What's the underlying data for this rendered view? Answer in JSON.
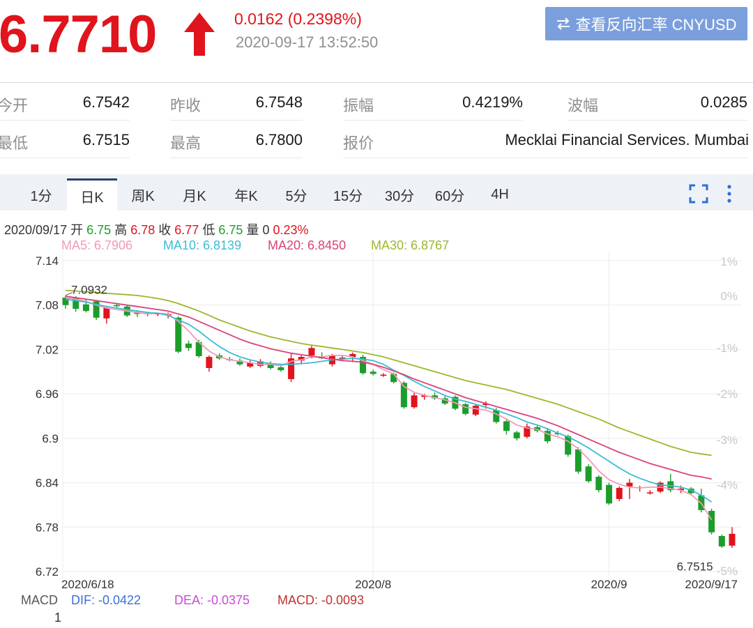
{
  "header": {
    "price": "6.7710",
    "change": "0.0162 (0.2398%)",
    "timestamp": "2020-09-17 13:52:50",
    "reverse_button": "查看反向汇率 CNYUSD"
  },
  "stats": [
    {
      "label": "今开",
      "value": "6.7542"
    },
    {
      "label": "昨收",
      "value": "6.7548"
    },
    {
      "label": "振幅",
      "value": "0.4219%"
    },
    {
      "label": "波幅",
      "value": "0.0285"
    },
    {
      "label": "最低",
      "value": "6.7515"
    },
    {
      "label": "最高",
      "value": "6.7800"
    },
    {
      "label": "报价",
      "value": "Mecklai Financial Services. Mumbai"
    }
  ],
  "tabs": [
    "1分",
    "日K",
    "周K",
    "月K",
    "年K",
    "5分",
    "15分",
    "30分",
    "60分",
    "4H"
  ],
  "active_tab": "日K",
  "info": {
    "date": "2020/09/17",
    "open_label": "开",
    "open": "6.75",
    "high_label": "高",
    "high": "6.78",
    "close_label": "收",
    "close": "6.77",
    "low_label": "低",
    "low": "6.75",
    "vol_label": "量",
    "vol": "0",
    "pct": "0.23%"
  },
  "ma": [
    {
      "label": "MA5: 6.7906",
      "color": "#f09bb8"
    },
    {
      "label": "MA10: 6.8139",
      "color": "#3cbcd3"
    },
    {
      "label": "MA20: 6.8450",
      "color": "#d9427a"
    },
    {
      "label": "MA30: 6.8767",
      "color": "#9ab82c"
    }
  ],
  "macd": {
    "label": "MACD",
    "dif": "DIF: -0.0422",
    "dea": "DEA: -0.0375",
    "macd": "MACD: -0.0093",
    "axis_tick": "1"
  },
  "colors": {
    "up": "#e0141c",
    "down": "#1b9d2b",
    "accent_button": "#7b9fdd"
  },
  "chart_data": {
    "type": "candlestick",
    "ylim": [
      6.72,
      7.14
    ],
    "y_ticks": [
      "7.14",
      "7.08",
      "7.02",
      "6.96",
      "6.9",
      "6.84",
      "6.78",
      "6.72"
    ],
    "y_tick_values": [
      7.14,
      7.08,
      7.02,
      6.96,
      6.9,
      6.84,
      6.78,
      6.72
    ],
    "pct_ticks": [
      "1%",
      "0%",
      "-1%",
      "-2%",
      "-3%",
      "-4%",
      "-5%"
    ],
    "pct_tick_values": [
      7.14,
      7.0932,
      7.023,
      6.961,
      6.899,
      6.838,
      6.722
    ],
    "x_labels": [
      {
        "label": "2020/6/18",
        "index": 0
      },
      {
        "label": "2020/8",
        "index": 30
      },
      {
        "label": "2020/9",
        "index": 53
      },
      {
        "label": "2020/9/17",
        "index": 63
      }
    ],
    "grid_x_indices": [
      30,
      53
    ],
    "annotations": [
      {
        "text": "7.0932",
        "index": 0,
        "value": 7.0932
      },
      {
        "text": "6.7515",
        "index": 63,
        "value": 6.7515
      }
    ],
    "candles": [
      {
        "o": 7.09,
        "h": 7.093,
        "l": 7.075,
        "c": 7.08
      },
      {
        "o": 7.09,
        "h": 7.092,
        "l": 7.071,
        "c": 7.075
      },
      {
        "o": 7.081,
        "h": 7.088,
        "l": 7.07,
        "c": 7.072
      },
      {
        "o": 7.085,
        "h": 7.087,
        "l": 7.06,
        "c": 7.063
      },
      {
        "o": 7.062,
        "h": 7.078,
        "l": 7.055,
        "c": 7.076
      },
      {
        "o": 7.08,
        "h": 7.083,
        "l": 7.077,
        "c": 7.079
      },
      {
        "o": 7.078,
        "h": 7.08,
        "l": 7.064,
        "c": 7.066
      },
      {
        "o": 7.07,
        "h": 7.073,
        "l": 7.064,
        "c": 7.068
      },
      {
        "o": 7.068,
        "h": 7.071,
        "l": 7.065,
        "c": 7.069
      },
      {
        "o": 7.068,
        "h": 7.07,
        "l": 7.065,
        "c": 7.069
      },
      {
        "o": 7.066,
        "h": 7.07,
        "l": 7.062,
        "c": 7.068
      },
      {
        "o": 7.063,
        "h": 7.065,
        "l": 7.015,
        "c": 7.017
      },
      {
        "o": 7.028,
        "h": 7.032,
        "l": 7.018,
        "c": 7.022
      },
      {
        "o": 7.03,
        "h": 7.033,
        "l": 7.009,
        "c": 7.011
      },
      {
        "o": 6.995,
        "h": 7.012,
        "l": 6.99,
        "c": 7.01
      },
      {
        "o": 7.012,
        "h": 7.015,
        "l": 7.006,
        "c": 7.008
      },
      {
        "o": 7.007,
        "h": 7.01,
        "l": 7.004,
        "c": 7.006
      },
      {
        "o": 7.005,
        "h": 7.008,
        "l": 6.998,
        "c": 7.0
      },
      {
        "o": 6.997,
        "h": 7.005,
        "l": 6.995,
        "c": 7.002
      },
      {
        "o": 6.998,
        "h": 7.007,
        "l": 6.996,
        "c": 7.004
      },
      {
        "o": 7.0,
        "h": 7.004,
        "l": 6.993,
        "c": 6.995
      },
      {
        "o": 6.996,
        "h": 6.999,
        "l": 6.99,
        "c": 6.992
      },
      {
        "o": 6.98,
        "h": 7.015,
        "l": 6.976,
        "c": 7.008
      },
      {
        "o": 7.005,
        "h": 7.012,
        "l": 7.0,
        "c": 7.01
      },
      {
        "o": 7.012,
        "h": 7.025,
        "l": 7.008,
        "c": 7.022
      },
      {
        "o": 7.01,
        "h": 7.016,
        "l": 7.007,
        "c": 7.008
      },
      {
        "o": 7.0,
        "h": 7.014,
        "l": 6.997,
        "c": 7.012
      },
      {
        "o": 7.008,
        "h": 7.012,
        "l": 7.005,
        "c": 7.009
      },
      {
        "o": 7.01,
        "h": 7.016,
        "l": 7.003,
        "c": 7.014
      },
      {
        "o": 7.01,
        "h": 7.013,
        "l": 6.986,
        "c": 6.988
      },
      {
        "o": 6.99,
        "h": 6.993,
        "l": 6.985,
        "c": 6.987
      },
      {
        "o": 6.985,
        "h": 6.988,
        "l": 6.983,
        "c": 6.986
      },
      {
        "o": 6.987,
        "h": 6.989,
        "l": 6.974,
        "c": 6.976
      },
      {
        "o": 6.975,
        "h": 6.977,
        "l": 6.94,
        "c": 6.942
      },
      {
        "o": 6.942,
        "h": 6.962,
        "l": 6.94,
        "c": 6.958
      },
      {
        "o": 6.956,
        "h": 6.96,
        "l": 6.952,
        "c": 6.958
      },
      {
        "o": 6.958,
        "h": 6.962,
        "l": 6.952,
        "c": 6.954
      },
      {
        "o": 6.954,
        "h": 6.957,
        "l": 6.945,
        "c": 6.947
      },
      {
        "o": 6.956,
        "h": 6.958,
        "l": 6.938,
        "c": 6.94
      },
      {
        "o": 6.946,
        "h": 6.948,
        "l": 6.931,
        "c": 6.933
      },
      {
        "o": 6.932,
        "h": 6.946,
        "l": 6.93,
        "c": 6.944
      },
      {
        "o": 6.945,
        "h": 6.95,
        "l": 6.94,
        "c": 6.947
      },
      {
        "o": 6.938,
        "h": 6.941,
        "l": 6.92,
        "c": 6.922
      },
      {
        "o": 6.923,
        "h": 6.925,
        "l": 6.905,
        "c": 6.91
      },
      {
        "o": 6.908,
        "h": 6.91,
        "l": 6.897,
        "c": 6.9
      },
      {
        "o": 6.902,
        "h": 6.92,
        "l": 6.9,
        "c": 6.916
      },
      {
        "o": 6.915,
        "h": 6.918,
        "l": 6.908,
        "c": 6.91
      },
      {
        "o": 6.91,
        "h": 6.914,
        "l": 6.893,
        "c": 6.896
      },
      {
        "o": 6.907,
        "h": 6.91,
        "l": 6.904,
        "c": 6.906
      },
      {
        "o": 6.903,
        "h": 6.905,
        "l": 6.875,
        "c": 6.878
      },
      {
        "o": 6.885,
        "h": 6.888,
        "l": 6.852,
        "c": 6.855
      },
      {
        "o": 6.862,
        "h": 6.865,
        "l": 6.84,
        "c": 6.842
      },
      {
        "o": 6.848,
        "h": 6.85,
        "l": 6.827,
        "c": 6.83
      },
      {
        "o": 6.837,
        "h": 6.84,
        "l": 6.81,
        "c": 6.812
      },
      {
        "o": 6.818,
        "h": 6.835,
        "l": 6.815,
        "c": 6.833
      },
      {
        "o": 6.835,
        "h": 6.845,
        "l": 6.818,
        "c": 6.84
      },
      {
        "o": 6.833,
        "h": 6.836,
        "l": 6.828,
        "c": 6.834
      },
      {
        "o": 6.826,
        "h": 6.83,
        "l": 6.824,
        "c": 6.827
      },
      {
        "o": 6.828,
        "h": 6.842,
        "l": 6.826,
        "c": 6.84
      },
      {
        "o": 6.842,
        "h": 6.852,
        "l": 6.827,
        "c": 6.83
      },
      {
        "o": 6.83,
        "h": 6.836,
        "l": 6.826,
        "c": 6.832
      },
      {
        "o": 6.832,
        "h": 6.834,
        "l": 6.823,
        "c": 6.826
      },
      {
        "o": 6.823,
        "h": 6.832,
        "l": 6.8,
        "c": 6.803
      },
      {
        "o": 6.802,
        "h": 6.805,
        "l": 6.77,
        "c": 6.773
      },
      {
        "o": 6.768,
        "h": 6.77,
        "l": 6.752,
        "c": 6.754
      },
      {
        "o": 6.755,
        "h": 6.78,
        "l": 6.752,
        "c": 6.771
      }
    ],
    "ma_series": [
      {
        "name": "MA5",
        "color": "#f09bb8",
        "values": [
          7.09,
          7.088,
          7.085,
          7.08,
          7.076,
          7.074,
          7.072,
          7.07,
          7.068,
          7.069,
          7.068,
          7.058,
          7.045,
          7.03,
          7.018,
          7.01,
          7.006,
          7.004,
          7.002,
          7.0,
          7.0,
          6.998,
          7.004,
          7.006,
          7.01,
          7.01,
          7.012,
          7.012,
          7.01,
          7.005,
          7.0,
          6.993,
          6.987,
          6.97,
          6.962,
          6.958,
          6.955,
          6.952,
          6.948,
          6.942,
          6.94,
          6.938,
          6.933,
          6.926,
          6.918,
          6.914,
          6.912,
          6.906,
          6.902,
          6.896,
          6.886,
          6.872,
          6.856,
          6.844,
          6.838,
          6.834,
          6.833,
          6.834,
          6.834,
          6.832,
          6.83,
          6.824,
          6.812,
          6.79
        ]
      },
      {
        "name": "MA10",
        "color": "#3cbcd3",
        "values": [
          7.088,
          7.086,
          7.084,
          7.081,
          7.078,
          7.076,
          7.074,
          7.072,
          7.07,
          7.069,
          7.066,
          7.06,
          7.054,
          7.045,
          7.034,
          7.024,
          7.016,
          7.01,
          7.006,
          7.003,
          7.001,
          7.0,
          7.0,
          7.001,
          7.002,
          7.004,
          7.006,
          7.007,
          7.008,
          7.007,
          7.005,
          7.0,
          6.992,
          6.985,
          6.977,
          6.97,
          6.964,
          6.958,
          6.953,
          6.95,
          6.946,
          6.942,
          6.938,
          6.933,
          6.928,
          6.922,
          6.918,
          6.913,
          6.907,
          6.902,
          6.895,
          6.887,
          6.878,
          6.869,
          6.86,
          6.852,
          6.846,
          6.841,
          6.837,
          6.836,
          6.834,
          6.83,
          6.823,
          6.814
        ]
      },
      {
        "name": "MA20",
        "color": "#d9427a",
        "values": [
          7.092,
          7.09,
          7.088,
          7.086,
          7.084,
          7.082,
          7.08,
          7.078,
          7.076,
          7.074,
          7.072,
          7.068,
          7.064,
          7.058,
          7.052,
          7.046,
          7.04,
          7.034,
          7.029,
          7.025,
          7.021,
          7.018,
          7.015,
          7.013,
          7.011,
          7.009,
          7.007,
          7.005,
          7.004,
          7.003,
          7.0,
          6.996,
          6.991,
          6.986,
          6.98,
          6.975,
          6.97,
          6.965,
          6.96,
          6.955,
          6.951,
          6.947,
          6.943,
          6.939,
          6.935,
          6.931,
          6.927,
          6.922,
          6.917,
          6.911,
          6.905,
          6.899,
          6.893,
          6.887,
          6.881,
          6.876,
          6.871,
          6.866,
          6.862,
          6.858,
          6.854,
          6.85,
          6.848,
          6.845
        ]
      },
      {
        "name": "MA30",
        "color": "#9ab82c",
        "values": [
          7.1,
          7.099,
          7.098,
          7.097,
          7.096,
          7.095,
          7.094,
          7.093,
          7.091,
          7.089,
          7.086,
          7.082,
          7.077,
          7.072,
          7.066,
          7.06,
          7.055,
          7.05,
          7.045,
          7.041,
          7.037,
          7.034,
          7.031,
          7.028,
          7.026,
          7.024,
          7.022,
          7.02,
          7.018,
          7.016,
          7.013,
          7.01,
          7.006,
          7.002,
          6.998,
          6.994,
          6.99,
          6.986,
          6.982,
          6.978,
          6.975,
          6.972,
          6.969,
          6.966,
          6.962,
          6.958,
          6.954,
          6.95,
          6.946,
          6.941,
          6.936,
          6.931,
          6.926,
          6.92,
          6.914,
          6.909,
          6.904,
          6.899,
          6.894,
          6.889,
          6.885,
          6.881,
          6.879,
          6.877
        ]
      }
    ]
  }
}
